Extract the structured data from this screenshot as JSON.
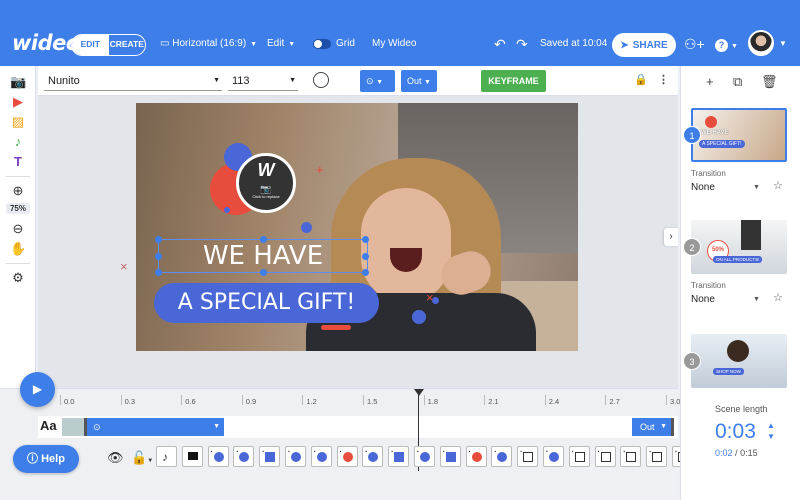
{
  "header": {
    "logo": "wideo",
    "mode_edit": "EDIT",
    "mode_create": "CREATE",
    "orientation": "Horizontal (16:9)",
    "edit_menu": "Edit",
    "grid_label": "Grid",
    "project_name": "My Wideo",
    "saved_status": "Saved at 10:04",
    "share_label": "SHARE",
    "help_icon": "?"
  },
  "toolbar": {
    "font_family": "Nunito",
    "font_size": "113",
    "entrance_anim": "⊙",
    "out_label": "Out",
    "keyframe_label": "KEYFRAME"
  },
  "left_tools": {
    "zoom_level": "75%"
  },
  "stage": {
    "line1": "WE HAVE",
    "line2": "A SPECIAL GIFT!",
    "logo_placeholder_caption": "Click to replace",
    "logo_glyph": "W"
  },
  "scenes": [
    {
      "number": "1",
      "thumb_line1": "WE HAVE",
      "thumb_line2": "A SPECIAL GIFT!",
      "transition_label": "Transition",
      "transition_value": "None"
    },
    {
      "number": "2",
      "thumb_badge": "50%",
      "thumb_banner": "ON ALL PRODUCTS!",
      "transition_label": "Transition",
      "transition_value": "None"
    },
    {
      "number": "3",
      "thumb_banner": "SHOP NOW"
    }
  ],
  "timeline": {
    "ticks": [
      "0.0",
      "0.3",
      "0.6",
      "0.9",
      "1.2",
      "1.5",
      "1.8",
      "2.1",
      "2.4",
      "2.7",
      "3.0"
    ],
    "text_layer_label": "Aa",
    "out_label": "Out",
    "help_label": "Help"
  },
  "scene_length": {
    "label": "Scene length",
    "value": "0:03",
    "current": "0:02",
    "separator": "/",
    "total": "0:15"
  },
  "colors": {
    "brand_blue": "#3d7ee8",
    "keyframe_green": "#4caf50",
    "accent_red": "#e84c3d",
    "shape_blue": "#4a67d8"
  },
  "icons": {
    "undo": "undo-icon",
    "redo": "redo-icon",
    "share": "paper-plane-icon",
    "add_user": "add-user-icon",
    "play": "play-icon",
    "eye": "eye-icon",
    "lock": "lock-icon",
    "music": "music-note-icon"
  }
}
